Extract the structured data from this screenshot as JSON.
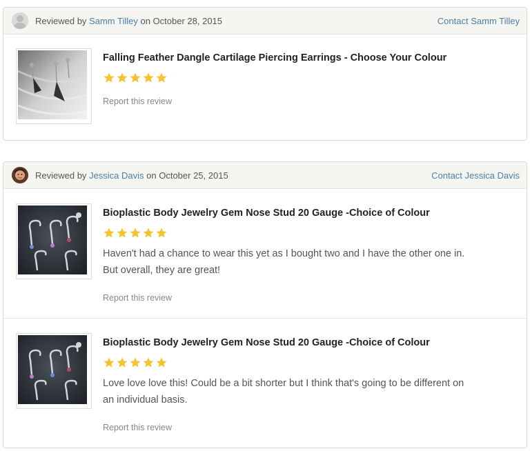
{
  "colors": {
    "link": "#4a7fa8",
    "star": "#f4c430",
    "header_bg": "#f5f5f1"
  },
  "reviews": [
    {
      "header": {
        "prefix": "Reviewed by",
        "reviewer": "Samm Tilley",
        "date_text": "on October 28, 2015",
        "contact": "Contact Samm Tilley",
        "avatar_icon": "default-avatar-icon"
      },
      "items": [
        {
          "title": "Falling Feather Dangle Cartilage Piercing Earrings - Choose Your Colour",
          "rating": 5,
          "text": "",
          "report": "Report this review"
        }
      ]
    },
    {
      "header": {
        "prefix": "Reviewed by",
        "reviewer": "Jessica Davis",
        "date_text": "on October 25, 2015",
        "contact": "Contact Jessica Davis",
        "avatar_icon": "user-photo-avatar-icon"
      },
      "items": [
        {
          "title": "Bioplastic Body Jewelry Gem Nose Stud 20 Gauge -Choice of Colour",
          "rating": 5,
          "text": "Haven't had a chance to wear this yet as I bought two and I have the other one in. But overall, they are great!",
          "report": "Report this review"
        },
        {
          "title": "Bioplastic Body Jewelry Gem Nose Stud 20 Gauge -Choice of Colour",
          "rating": 5,
          "text": "Love love love this! Could be a bit shorter but I think that's going to be different on an individual basis.",
          "report": "Report this review"
        }
      ]
    }
  ]
}
